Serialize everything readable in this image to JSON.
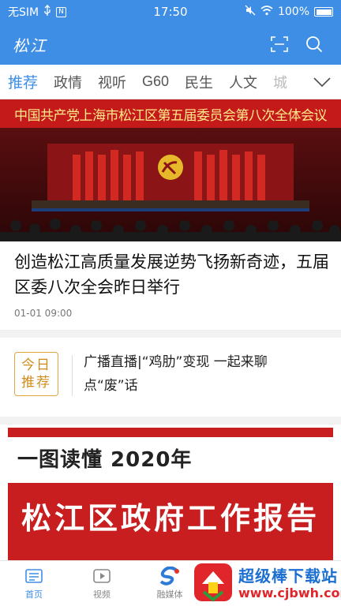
{
  "status": {
    "carrier": "无SIM",
    "small_box": "N",
    "time": "17:50",
    "battery": "100%"
  },
  "header": {
    "logo": "松江"
  },
  "tabs": [
    {
      "label": "推荐"
    },
    {
      "label": "政情"
    },
    {
      "label": "视听"
    },
    {
      "label": "G60"
    },
    {
      "label": "民生"
    },
    {
      "label": "人文"
    },
    {
      "label": "城"
    }
  ],
  "hero": {
    "banner": "中国共产党上海市松江区第五届委员会第八次全体会议"
  },
  "headline": {
    "title": "创造松江高质量发展逆势飞扬新奇迹，五届区委八次全会昨日举行",
    "time": "01-01 09:00"
  },
  "promo": {
    "badge_line1": "今日",
    "badge_line2": "推荐",
    "text": "广播直播|“鸡肋”变现 一起来聊点“废”话"
  },
  "report": {
    "top": "一图读懂 2020年",
    "title": "松江区政府工作报告"
  },
  "bottom_nav": [
    {
      "label": "首页"
    },
    {
      "label": "视频"
    },
    {
      "label": "融媒体"
    },
    {
      "label": ""
    },
    {
      "label": ""
    }
  ],
  "watermark": {
    "text": "超级棒下载站",
    "url": "www.cjbwh.com"
  },
  "colors": {
    "brand": "#3d8ee4",
    "report_red": "#c81e20",
    "badge": "#d08b1a"
  }
}
